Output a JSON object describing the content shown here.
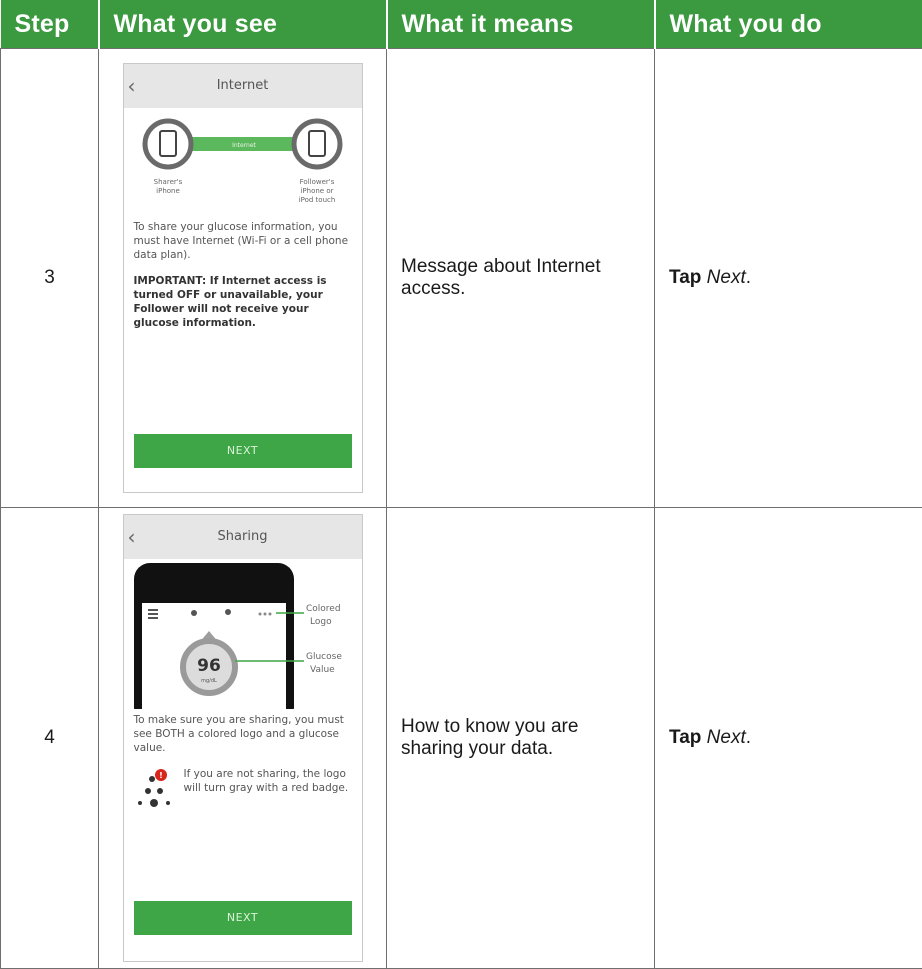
{
  "table": {
    "headers": [
      "Step",
      "What you see",
      "What it means",
      "What you do"
    ],
    "rows": [
      {
        "step": "3",
        "means": "Message about Internet access.",
        "action_bold": "Tap",
        "action_italic": "Next",
        "action_end": "."
      },
      {
        "step": "4",
        "means": "How to know you are sharing your data.",
        "action_bold": "Tap",
        "action_italic": "Next",
        "action_end": "."
      }
    ]
  },
  "screen3": {
    "title": "Internet",
    "connector_label": "Internet",
    "sharer_label_line1": "Sharer's",
    "sharer_label_line2": "iPhone",
    "follower_label_line1": "Follower's",
    "follower_label_line2": "iPhone or",
    "follower_label_line3": "iPod touch",
    "body": "To share your glucose information, you must have Internet (Wi-Fi or a cell phone data plan).",
    "important": "IMPORTANT: If Internet access is turned OFF or unavailable, your Follower will not receive your glucose information.",
    "button": "NEXT"
  },
  "screen4": {
    "title": "Sharing",
    "label_logo_line1": "Colored",
    "label_logo_line2": "Logo",
    "label_glucose_line1": "Glucose",
    "label_glucose_line2": "Value",
    "glucose_value": "96",
    "glucose_unit": "mg/dL",
    "body": "To make sure you are sharing, you must see BOTH a colored logo and a glucose value.",
    "gray_note": "If you are not sharing, the logo will turn gray with a red badge.",
    "badge_count": "!",
    "button": "NEXT"
  },
  "colors": {
    "header_green": "#3b9a3f",
    "button_green": "#3fa647",
    "badge_red": "#d9261c"
  }
}
